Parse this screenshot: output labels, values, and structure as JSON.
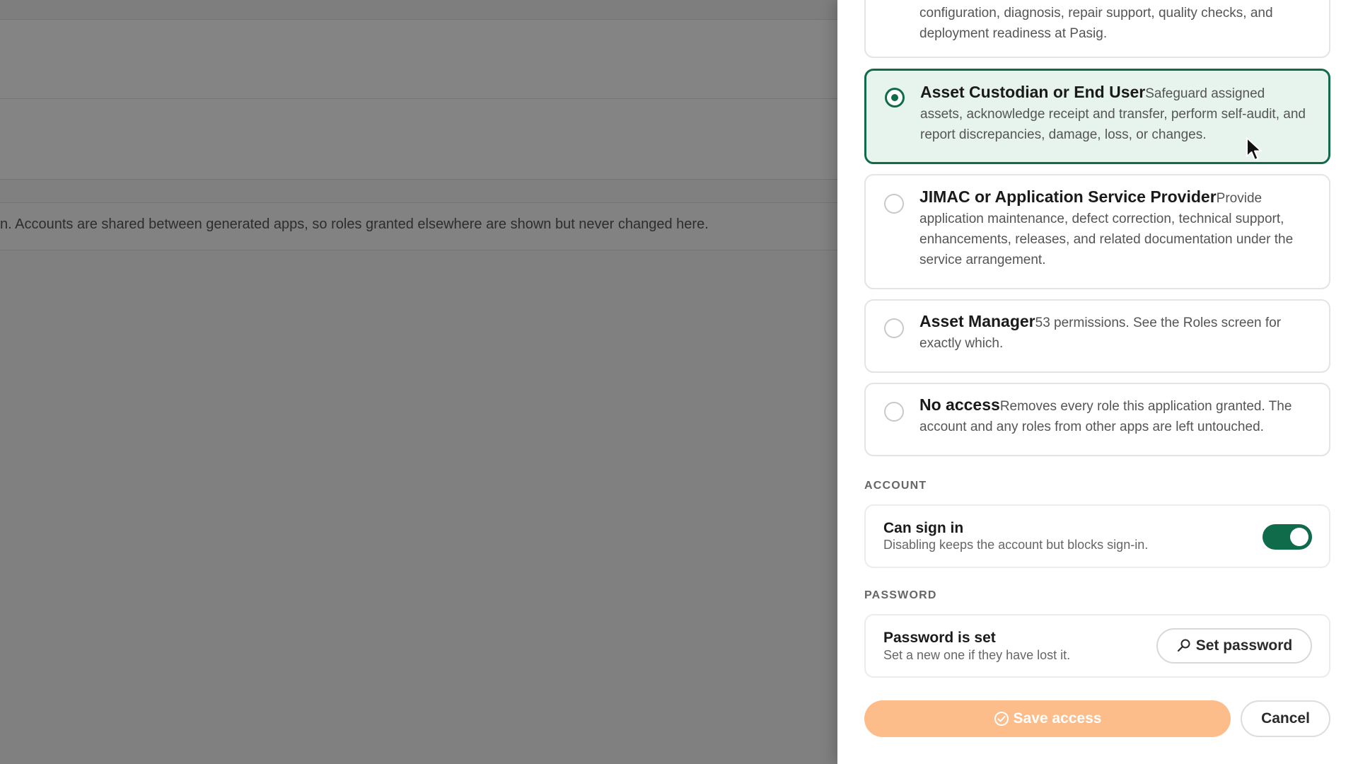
{
  "background": {
    "note": "n. Accounts are shared between generated apps, so roles granted elsewhere are shown but never changed here."
  },
  "roles": [
    {
      "name": "",
      "description": "configuration, diagnosis, repair support, quality checks, and deployment readiness at Pasig.",
      "selected": false
    },
    {
      "name": "Asset Custodian or End User",
      "description": "Safeguard assigned assets, acknowledge receipt and transfer, perform self-audit, and report discrepancies, damage, loss, or changes.",
      "selected": true
    },
    {
      "name": "JIMAC or Application Service Provider",
      "description": "Provide application maintenance, defect correction, technical support, enhancements, releases, and related documentation under the service arrangement.",
      "selected": false
    },
    {
      "name": "Asset Manager",
      "description": "53 permissions. See the Roles screen for exactly which.",
      "selected": false
    },
    {
      "name": "No access",
      "description": "Removes every role this application granted. The account and any roles from other apps are left untouched.",
      "selected": false
    }
  ],
  "account": {
    "section_label": "ACCOUNT",
    "title": "Can sign in",
    "subtitle": "Disabling keeps the account but blocks sign-in.",
    "enabled": true
  },
  "password": {
    "section_label": "PASSWORD",
    "title": "Password is set",
    "subtitle": "Set a new one if they have lost it.",
    "button_label": "Set password"
  },
  "actions": {
    "save_label": "Save access",
    "cancel_label": "Cancel"
  },
  "colors": {
    "accent": "#0f6b49",
    "save_disabled": "#fcbd8a"
  },
  "icons": {
    "password_button": "search-key-icon",
    "save_button": "check-circle-icon"
  }
}
